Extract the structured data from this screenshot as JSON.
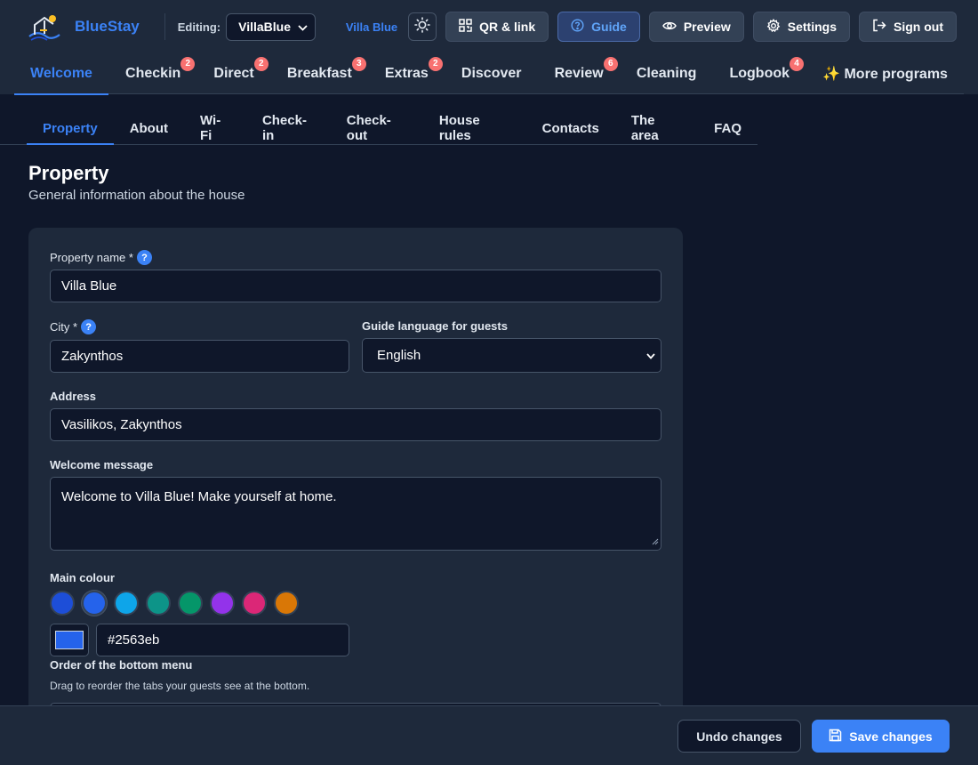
{
  "header": {
    "brand": "BlueStay",
    "editing_label": "Editing:",
    "property_select": "VillaBlue",
    "villa_link": "Villa Blue",
    "buttons": {
      "qr": "QR & link",
      "guide": "Guide",
      "preview": "Preview",
      "settings": "Settings",
      "signout": "Sign out"
    }
  },
  "nav": {
    "items": [
      {
        "label": "Welcome",
        "badge": ""
      },
      {
        "label": "Checkin",
        "badge": "2"
      },
      {
        "label": "Direct",
        "badge": "2"
      },
      {
        "label": "Breakfast",
        "badge": "3"
      },
      {
        "label": "Extras",
        "badge": "2"
      },
      {
        "label": "Discover",
        "badge": ""
      },
      {
        "label": "Review",
        "badge": "6"
      },
      {
        "label": "Cleaning",
        "badge": ""
      },
      {
        "label": "Logbook",
        "badge": "4"
      },
      {
        "label": "✨ More programs",
        "badge": ""
      }
    ]
  },
  "subtabs": [
    "Property",
    "About",
    "Wi-Fi",
    "Check-in",
    "Check-out",
    "House rules",
    "Contacts",
    "The area",
    "FAQ"
  ],
  "page": {
    "title": "Property",
    "subtitle": "General information about the house"
  },
  "form": {
    "property_name_label": "Property name *",
    "property_name_value": "Villa Blue",
    "city_label": "City *",
    "city_value": "Zakynthos",
    "language_label": "Guide language for guests",
    "language_value": "English",
    "address_label": "Address",
    "address_value": "Vasilikos, Zakynthos",
    "welcome_label": "Welcome message",
    "welcome_value": "Welcome to Villa Blue! Make yourself at home.",
    "colour_label": "Main colour",
    "colour_swatches": [
      "#1d4ed8",
      "#2563eb",
      "#0ea5e9",
      "#0d9488",
      "#059669",
      "#9333ea",
      "#db2777",
      "#d97706"
    ],
    "colour_hex": "#2563eb",
    "order_label": "Order of the bottom menu",
    "order_hint": "Drag to reorder the tabs your guests see at the bottom."
  },
  "footer": {
    "undo": "Undo changes",
    "save": "Save changes"
  },
  "colors": {
    "accent": "#3b82f6",
    "background": "#0f172a",
    "surface": "#1e293b",
    "badge": "#f87171"
  }
}
